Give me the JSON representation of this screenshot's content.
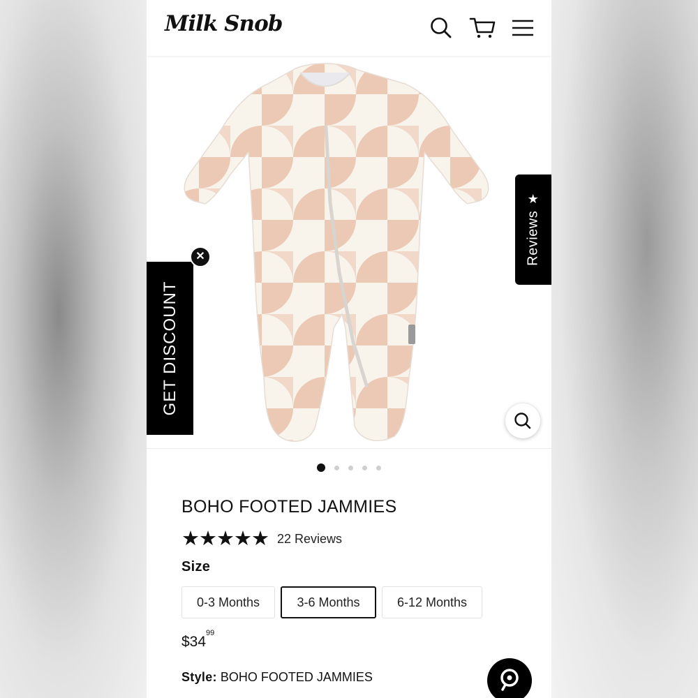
{
  "header": {
    "logo_text": "Milk Snob",
    "icons": [
      "search-icon",
      "cart-icon",
      "menu-icon"
    ]
  },
  "hero": {
    "reviews_tab_label": "Reviews",
    "discount_tab_label": "GET DISCOUNT",
    "carousel": {
      "total": 5,
      "active_index": 0
    }
  },
  "product": {
    "title": "BOHO FOOTED JAMMIES",
    "rating_value": 5,
    "rating_max": 5,
    "review_count": "22 Reviews",
    "size_label": "Size",
    "sizes": [
      {
        "label": "0-3 Months",
        "selected": false
      },
      {
        "label": "3-6 Months",
        "selected": true
      },
      {
        "label": "6-12 Months",
        "selected": false
      }
    ],
    "price_dollars": "$34",
    "price_cents": "99",
    "style_label": "Style:",
    "style_value": "BOHO FOOTED JAMMIES"
  },
  "colors": {
    "accent": "#000000",
    "fabric_pattern": "#e8c5b0",
    "fabric_base": "#f8f4ec"
  }
}
